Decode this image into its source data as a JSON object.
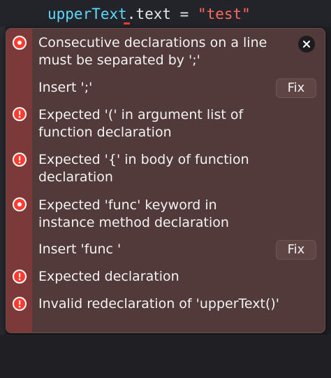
{
  "editor": {
    "code": {
      "ident": "upperText",
      "dot": ".",
      "prop": "text",
      "assign": " = ",
      "string": "\"test\""
    }
  },
  "issues": [
    {
      "severity": "error",
      "icon": "error-dot-icon",
      "message": "Consecutive declarations on a line must be separated by ';'"
    },
    {
      "severity": "fixit",
      "message": "Insert ';'",
      "fix_label": "Fix"
    },
    {
      "severity": "error",
      "icon": "error-exclamation-icon",
      "message": "Expected '(' in argument list of function declaration"
    },
    {
      "severity": "error",
      "icon": "error-exclamation-icon",
      "message": "Expected '{' in body of function declaration"
    },
    {
      "severity": "error",
      "icon": "error-dot-icon",
      "message": "Expected 'func' keyword in instance method declaration"
    },
    {
      "severity": "fixit",
      "message": "Insert 'func '",
      "fix_label": "Fix"
    },
    {
      "severity": "error",
      "icon": "error-exclamation-icon",
      "message": "Expected declaration"
    },
    {
      "severity": "error",
      "icon": "error-exclamation-icon",
      "message": "Invalid redeclaration of 'upperText()'"
    }
  ],
  "popover": {
    "close_icon": "close-icon"
  },
  "colors": {
    "popover_bg": "#513a39",
    "rail_bg": "#7b3a39",
    "error_red": "#ff3b30",
    "identifier_blue": "#5dd8ff",
    "string_red": "#fc6a5d"
  }
}
